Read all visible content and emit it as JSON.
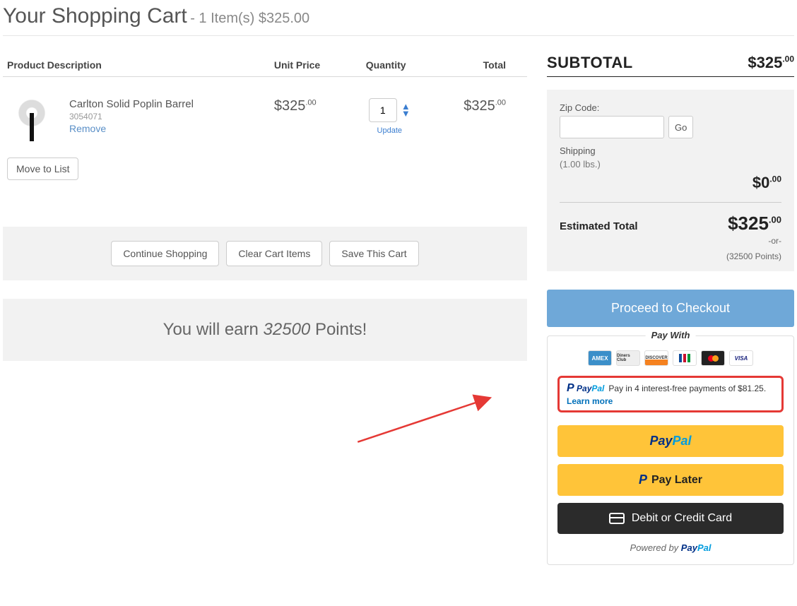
{
  "header": {
    "title": "Your Shopping Cart",
    "meta": "- 1 Item(s) $325.00"
  },
  "table": {
    "cols": {
      "desc": "Product Description",
      "unit": "Unit Price",
      "qty": "Quantity",
      "total": "Total"
    },
    "item": {
      "name": "Carlton Solid Poplin Barrel",
      "sku": "3054071",
      "remove": "Remove",
      "unit_whole": "$325",
      "unit_cents": ".00",
      "qty": "1",
      "update": "Update",
      "total_whole": "$325",
      "total_cents": ".00"
    },
    "move_btn": "Move to List"
  },
  "actions": {
    "continue": "Continue Shopping",
    "clear": "Clear Cart Items",
    "save": "Save This Cart"
  },
  "earn": {
    "prefix": "You will earn ",
    "points": "32500",
    "suffix": " Points!"
  },
  "sidebar": {
    "subtotal_label": "SUBTOTAL",
    "subtotal_whole": "$325",
    "subtotal_cents": ".00",
    "zip_label": "Zip Code:",
    "go": "Go",
    "shipping": "Shipping",
    "weight": "(1.00 lbs.)",
    "zero_whole": "$0",
    "zero_cents": ".00",
    "est_label": "Estimated Total",
    "est_whole": "$325",
    "est_cents": ".00",
    "or": "-or-",
    "points_eq": "(32500 Points)",
    "proceed": "Proceed to Checkout",
    "pay_with": "Pay With",
    "cards": {
      "amex": "AMEX",
      "diners": "Diners Club",
      "discover": "DISCOVER",
      "visa": "VISA"
    },
    "paypal": {
      "brand_pay": "Pay",
      "brand_pal": "Pal",
      "msg": "Pay in 4 interest-free payments of $81.25.",
      "learn": "Learn more",
      "later": "Pay Later",
      "debit": "Debit or Credit Card",
      "powered": "Powered by "
    }
  }
}
